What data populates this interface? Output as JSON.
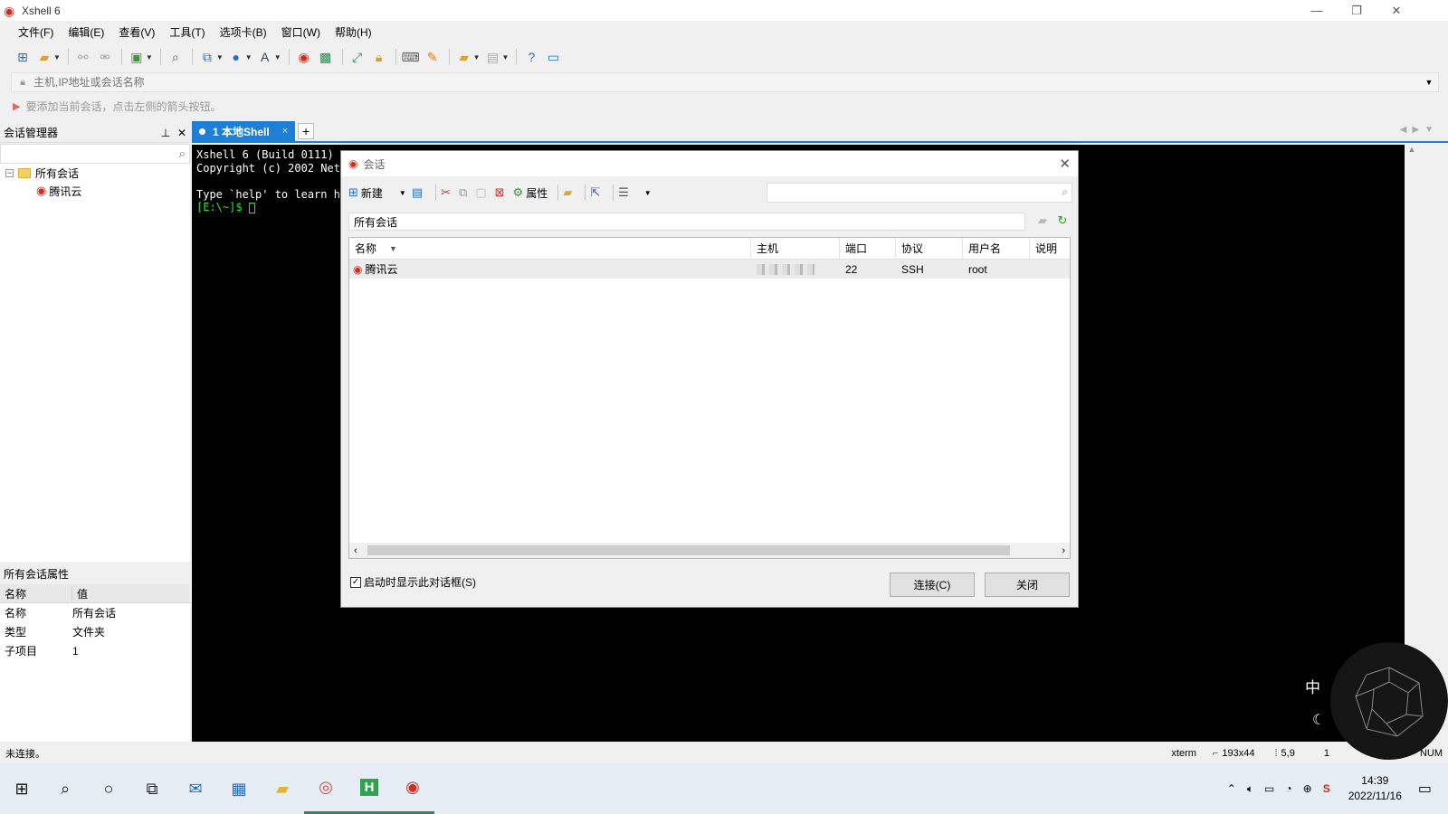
{
  "window": {
    "title": "Xshell 6",
    "min": "—",
    "restore": "❐",
    "close": "✕"
  },
  "menu": [
    "文件(F)",
    "编辑(E)",
    "查看(V)",
    "工具(T)",
    "选项卡(B)",
    "窗口(W)",
    "帮助(H)"
  ],
  "address": {
    "placeholder": "主机,IP地址或会话名称"
  },
  "hint": "要添加当前会话，点击左侧的箭头按钮。",
  "session_panel": {
    "title": "会话管理器",
    "tree": [
      {
        "label": "所有会话",
        "type": "folder"
      },
      {
        "label": "腾讯云",
        "type": "session"
      }
    ]
  },
  "props_panel": {
    "title": "所有会话属性",
    "header": {
      "k": "名称",
      "v": "值"
    },
    "rows": [
      {
        "k": "名称",
        "v": "所有会话"
      },
      {
        "k": "类型",
        "v": "文件夹"
      },
      {
        "k": "子项目",
        "v": "1"
      }
    ]
  },
  "tab": {
    "label": "1 本地Shell",
    "close": "×",
    "add": "+"
  },
  "terminal": {
    "line1": "Xshell 6 (Build 0111)",
    "line2": "Copyright (c) 2002 NetS",
    "line3": "Type `help' to learn ho",
    "prompt": "[E:\\~]$ "
  },
  "dialog": {
    "title": "会话",
    "toolbar": {
      "new": "新建",
      "props": "属性"
    },
    "path": "所有会话",
    "columns": [
      "名称",
      "主机",
      "端口",
      "协议",
      "用户名",
      "说明"
    ],
    "rows": [
      {
        "name": "腾讯云",
        "host": "",
        "port": "22",
        "protocol": "SSH",
        "user": "root",
        "desc": ""
      }
    ],
    "startup_label": "启动时显示此对话框(S)",
    "startup_checked": true,
    "connect": "连接(C)",
    "close": "关闭"
  },
  "status": {
    "left": "未连接。",
    "term": "xterm",
    "size": "193x44",
    "pos": "5,9",
    "sessions": "1",
    "num": "NUM"
  },
  "taskbar": {
    "time": "14:39",
    "date": "2022/11/16",
    "ime": "中"
  },
  "colors": {
    "accent": "#1e7fd6",
    "brand": "#d42a1c",
    "terminal_bg": "#000000"
  }
}
